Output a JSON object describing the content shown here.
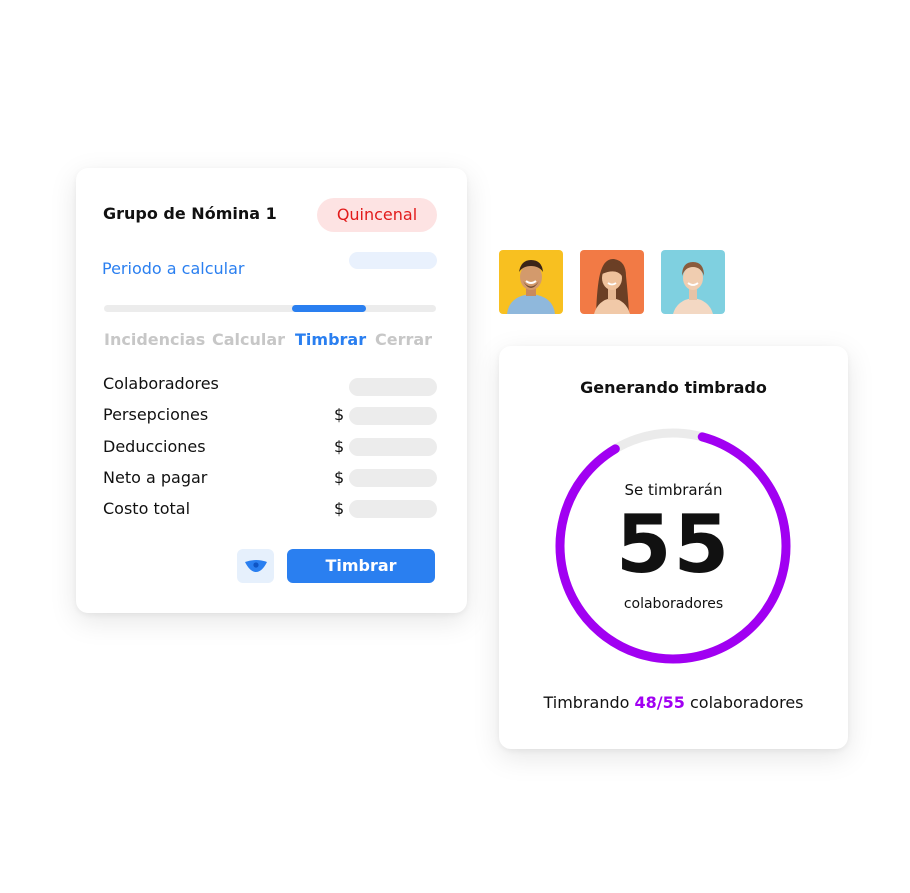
{
  "payroll_card": {
    "group_title": "Grupo de Nómina 1",
    "frequency_badge": "Quincenal",
    "period_label": "Periodo a calcular",
    "active_step_index": 2,
    "steps": [
      "Incidencias",
      "Calcular",
      "Timbrar",
      "Cerrar"
    ],
    "rows": [
      {
        "label": "Colaboradores",
        "currency": ""
      },
      {
        "label": "Persepciones",
        "currency": "$"
      },
      {
        "label": "Deducciones",
        "currency": "$"
      },
      {
        "label": "Neto a pagar",
        "currency": "$"
      },
      {
        "label": "Costo total",
        "currency": "$"
      }
    ],
    "preview_icon": "eye-icon",
    "action_label": "Timbrar"
  },
  "avatars": [
    {
      "name": "avatar-man",
      "bg": "#f8c020"
    },
    {
      "name": "avatar-woman-1",
      "bg": "#f27a45"
    },
    {
      "name": "avatar-woman-2",
      "bg": "#7fd0e0"
    }
  ],
  "stamping_card": {
    "title": "Generando timbrado",
    "ring_caption_top": "Se timbrarán",
    "ring_number": "55",
    "ring_caption_bottom": "colaboradores",
    "progress_completed": 48,
    "progress_total": 55,
    "status_prefix": "Timbrando",
    "status_count": "48/55",
    "status_suffix": "colaboradores"
  },
  "colors": {
    "accent_blue": "#2a7ff0",
    "badge_red": "#e21b1b",
    "badge_red_bg": "#fde3e3",
    "ring_purple": "#a100f2",
    "ring_track": "#ebebeb"
  }
}
